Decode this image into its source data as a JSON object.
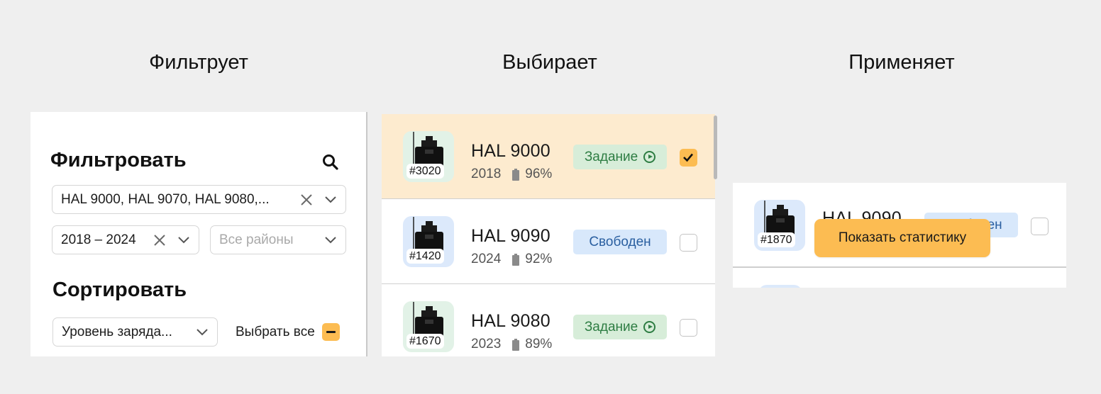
{
  "headings": [
    "Фильтрует",
    "Выбирает",
    "Применяет"
  ],
  "filter": {
    "title": "Фильтровать",
    "models_value": "HAL 9000, HAL 9070, HAL 9080,...",
    "years_value": "2018 – 2024",
    "districts_placeholder": "Все районы",
    "sort_title": "Сортировать",
    "sort_value": "Уровень заряда...",
    "select_all_label": "Выбрать все"
  },
  "list": {
    "rows": [
      {
        "id": "#3020",
        "name": "HAL 9000",
        "year": "2018",
        "battery": "96%",
        "status": "Задание",
        "status_type": "task",
        "checked": true,
        "thumb_color": "green"
      },
      {
        "id": "#1420",
        "name": "HAL 9090",
        "year": "2024",
        "battery": "92%",
        "status": "Свободен",
        "status_type": "free",
        "checked": false,
        "thumb_color": "blue"
      },
      {
        "id": "#1670",
        "name": "HAL 9080",
        "year": "2023",
        "battery": "89%",
        "status": "Задание",
        "status_type": "task",
        "checked": false,
        "thumb_color": "green"
      }
    ]
  },
  "apply": {
    "row": {
      "id": "#1870",
      "name": "HAL 9090",
      "status": "Свободен",
      "thumb_color": "blue"
    },
    "cta_label": "Показать статистику"
  },
  "colors": {
    "accent": "#fcbc52",
    "selected_row": "#fdebcf",
    "task_bg": "#d7edd9",
    "task_text": "#2e7d43",
    "free_bg": "#d8e8fb",
    "free_text": "#2a5fa0"
  }
}
